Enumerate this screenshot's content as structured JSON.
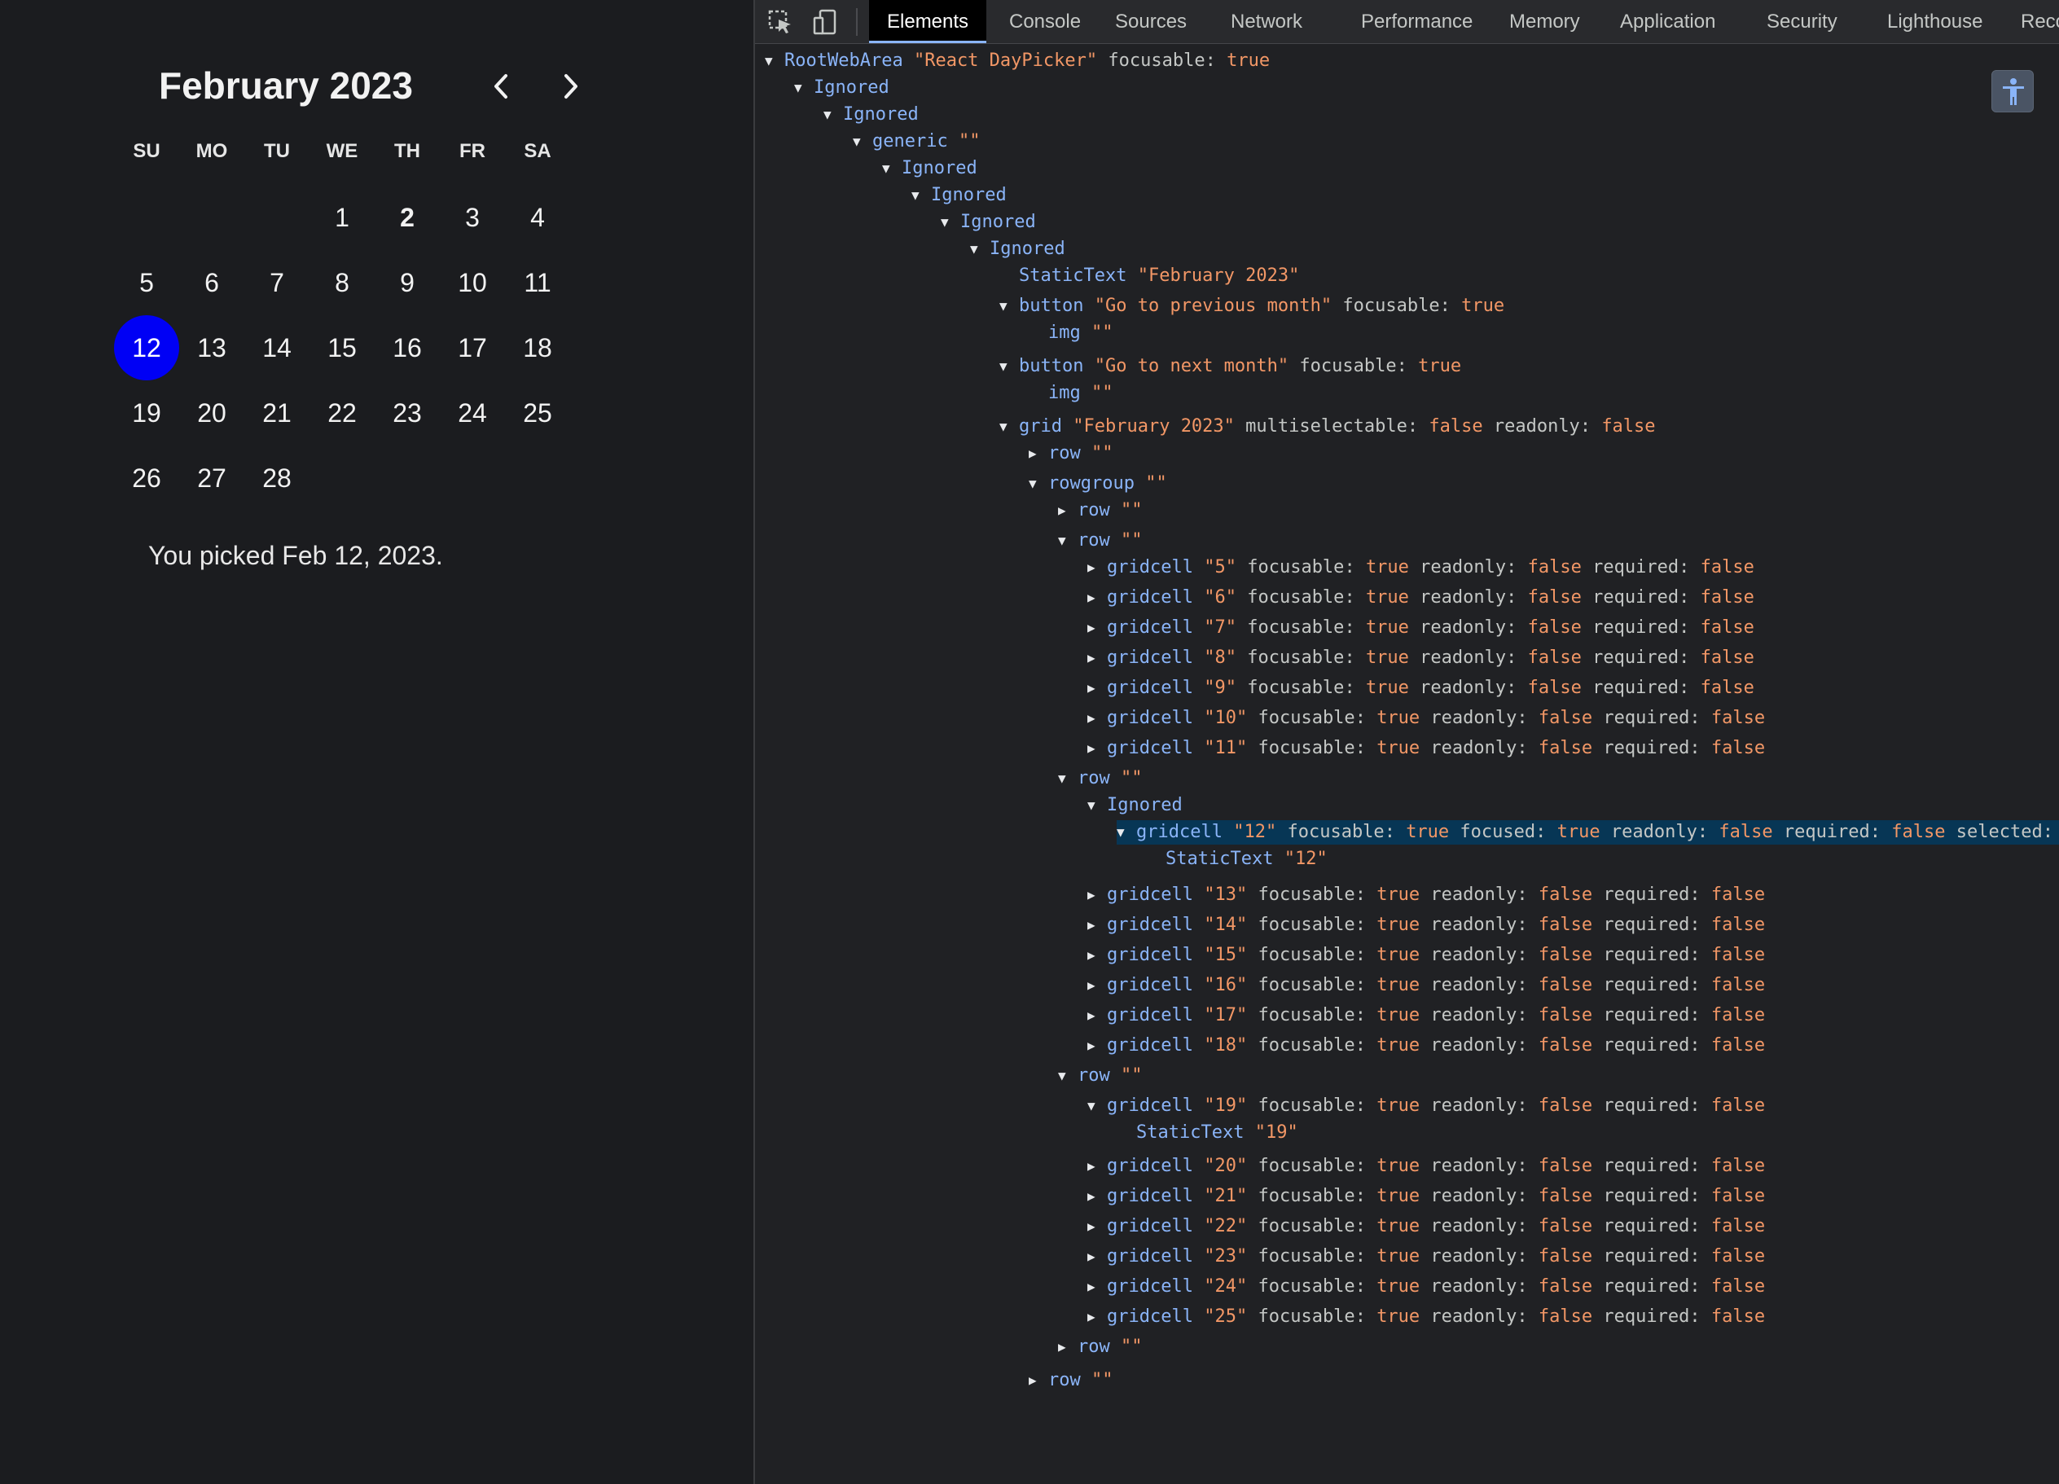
{
  "calendar": {
    "title": "February 2023",
    "weekdays": [
      "SU",
      "MO",
      "TU",
      "WE",
      "TH",
      "FR",
      "SA"
    ],
    "weeks": [
      [
        "",
        "",
        "",
        "1",
        "2",
        "3",
        "4"
      ],
      [
        "5",
        "6",
        "7",
        "8",
        "9",
        "10",
        "11"
      ],
      [
        "12",
        "13",
        "14",
        "15",
        "16",
        "17",
        "18"
      ],
      [
        "19",
        "20",
        "21",
        "22",
        "23",
        "24",
        "25"
      ],
      [
        "26",
        "27",
        "28",
        "",
        "",
        "",
        ""
      ]
    ],
    "today": "2",
    "selected": "12",
    "picked_text": "You picked Feb 12, 2023.",
    "prev_icon": "chevron-left-icon",
    "next_icon": "chevron-right-icon"
  },
  "devtools": {
    "tabs": [
      "Elements",
      "Console",
      "Sources",
      "Network",
      "Performance",
      "Memory",
      "Application",
      "Security",
      "Lighthouse",
      "Recorder"
    ],
    "active_tab": "Elements",
    "toolbar_icons": [
      "inspect-element-icon",
      "device-toolbar-icon"
    ],
    "accessibility_icon": "accessibility-person-icon",
    "tree": [
      {
        "t": "down",
        "role": "RootWebArea",
        "name": "React DayPicker",
        "props": [
          [
            "focusable",
            "true"
          ]
        ]
      },
      {
        "t": "down",
        "role": "Ignored"
      },
      {
        "t": "down",
        "role": "Ignored"
      },
      {
        "t": "down",
        "role": "generic",
        "name": ""
      },
      {
        "t": "down",
        "role": "Ignored"
      },
      {
        "t": "down",
        "role": "Ignored"
      },
      {
        "t": "down",
        "role": "Ignored"
      },
      {
        "t": "down",
        "role": "Ignored"
      },
      {
        "t": "",
        "role": "StaticText",
        "name": "February 2023"
      },
      {
        "t": "down",
        "role": "button",
        "name": "Go to previous month",
        "props": [
          [
            "focusable",
            "true"
          ]
        ]
      },
      {
        "t": "",
        "role": "img",
        "name": ""
      },
      {
        "t": "down",
        "role": "button",
        "name": "Go to next month",
        "props": [
          [
            "focusable",
            "true"
          ]
        ]
      },
      {
        "t": "",
        "role": "img",
        "name": ""
      },
      {
        "t": "down",
        "role": "grid",
        "name": "February 2023",
        "props": [
          [
            "multiselectable",
            "false"
          ],
          [
            "readonly",
            "false"
          ]
        ]
      },
      {
        "t": "right",
        "role": "row",
        "name": ""
      },
      {
        "t": "down",
        "role": "rowgroup",
        "name": ""
      },
      {
        "t": "right",
        "role": "row",
        "name": ""
      },
      {
        "t": "down",
        "role": "row",
        "name": ""
      },
      {
        "t": "right",
        "role": "gridcell",
        "name": "5",
        "props": [
          [
            "focusable",
            "true"
          ],
          [
            "readonly",
            "false"
          ],
          [
            "required",
            "false"
          ]
        ]
      },
      {
        "t": "right",
        "role": "gridcell",
        "name": "6",
        "props": [
          [
            "focusable",
            "true"
          ],
          [
            "readonly",
            "false"
          ],
          [
            "required",
            "false"
          ]
        ]
      },
      {
        "t": "right",
        "role": "gridcell",
        "name": "7",
        "props": [
          [
            "focusable",
            "true"
          ],
          [
            "readonly",
            "false"
          ],
          [
            "required",
            "false"
          ]
        ]
      },
      {
        "t": "right",
        "role": "gridcell",
        "name": "8",
        "props": [
          [
            "focusable",
            "true"
          ],
          [
            "readonly",
            "false"
          ],
          [
            "required",
            "false"
          ]
        ]
      },
      {
        "t": "right",
        "role": "gridcell",
        "name": "9",
        "props": [
          [
            "focusable",
            "true"
          ],
          [
            "readonly",
            "false"
          ],
          [
            "required",
            "false"
          ]
        ]
      },
      {
        "t": "right",
        "role": "gridcell",
        "name": "10",
        "props": [
          [
            "focusable",
            "true"
          ],
          [
            "readonly",
            "false"
          ],
          [
            "required",
            "false"
          ]
        ]
      },
      {
        "t": "right",
        "role": "gridcell",
        "name": "11",
        "props": [
          [
            "focusable",
            "true"
          ],
          [
            "readonly",
            "false"
          ],
          [
            "required",
            "false"
          ]
        ]
      },
      {
        "t": "down",
        "role": "row",
        "name": ""
      },
      {
        "t": "down",
        "role": "Ignored"
      },
      {
        "t": "down",
        "role": "gridcell",
        "name": "12",
        "props": [
          [
            "focusable",
            "true"
          ],
          [
            "focused",
            "true"
          ],
          [
            "readonly",
            "false"
          ],
          [
            "required",
            "false"
          ],
          [
            "selected",
            "true"
          ]
        ],
        "selected": true
      },
      {
        "t": "",
        "role": "StaticText",
        "name": "12"
      },
      {
        "t": "right",
        "role": "gridcell",
        "name": "13",
        "props": [
          [
            "focusable",
            "true"
          ],
          [
            "readonly",
            "false"
          ],
          [
            "required",
            "false"
          ]
        ]
      },
      {
        "t": "right",
        "role": "gridcell",
        "name": "14",
        "props": [
          [
            "focusable",
            "true"
          ],
          [
            "readonly",
            "false"
          ],
          [
            "required",
            "false"
          ]
        ]
      },
      {
        "t": "right",
        "role": "gridcell",
        "name": "15",
        "props": [
          [
            "focusable",
            "true"
          ],
          [
            "readonly",
            "false"
          ],
          [
            "required",
            "false"
          ]
        ]
      },
      {
        "t": "right",
        "role": "gridcell",
        "name": "16",
        "props": [
          [
            "focusable",
            "true"
          ],
          [
            "readonly",
            "false"
          ],
          [
            "required",
            "false"
          ]
        ]
      },
      {
        "t": "right",
        "role": "gridcell",
        "name": "17",
        "props": [
          [
            "focusable",
            "true"
          ],
          [
            "readonly",
            "false"
          ],
          [
            "required",
            "false"
          ]
        ]
      },
      {
        "t": "right",
        "role": "gridcell",
        "name": "18",
        "props": [
          [
            "focusable",
            "true"
          ],
          [
            "readonly",
            "false"
          ],
          [
            "required",
            "false"
          ]
        ]
      },
      {
        "t": "down",
        "role": "row",
        "name": ""
      },
      {
        "t": "down",
        "role": "gridcell",
        "name": "19",
        "props": [
          [
            "focusable",
            "true"
          ],
          [
            "readonly",
            "false"
          ],
          [
            "required",
            "false"
          ]
        ]
      },
      {
        "t": "",
        "role": "StaticText",
        "name": "19"
      },
      {
        "t": "right",
        "role": "gridcell",
        "name": "20",
        "props": [
          [
            "focusable",
            "true"
          ],
          [
            "readonly",
            "false"
          ],
          [
            "required",
            "false"
          ]
        ]
      },
      {
        "t": "right",
        "role": "gridcell",
        "name": "21",
        "props": [
          [
            "focusable",
            "true"
          ],
          [
            "readonly",
            "false"
          ],
          [
            "required",
            "false"
          ]
        ]
      },
      {
        "t": "right",
        "role": "gridcell",
        "name": "22",
        "props": [
          [
            "focusable",
            "true"
          ],
          [
            "readonly",
            "false"
          ],
          [
            "required",
            "false"
          ]
        ]
      },
      {
        "t": "right",
        "role": "gridcell",
        "name": "23",
        "props": [
          [
            "focusable",
            "true"
          ],
          [
            "readonly",
            "false"
          ],
          [
            "required",
            "false"
          ]
        ]
      },
      {
        "t": "right",
        "role": "gridcell",
        "name": "24",
        "props": [
          [
            "focusable",
            "true"
          ],
          [
            "readonly",
            "false"
          ],
          [
            "required",
            "false"
          ]
        ]
      },
      {
        "t": "right",
        "role": "gridcell",
        "name": "25",
        "props": [
          [
            "focusable",
            "true"
          ],
          [
            "readonly",
            "false"
          ],
          [
            "required",
            "false"
          ]
        ]
      },
      {
        "t": "right",
        "role": "row",
        "name": ""
      },
      {
        "t": "right",
        "role": "row",
        "name": ""
      }
    ]
  }
}
